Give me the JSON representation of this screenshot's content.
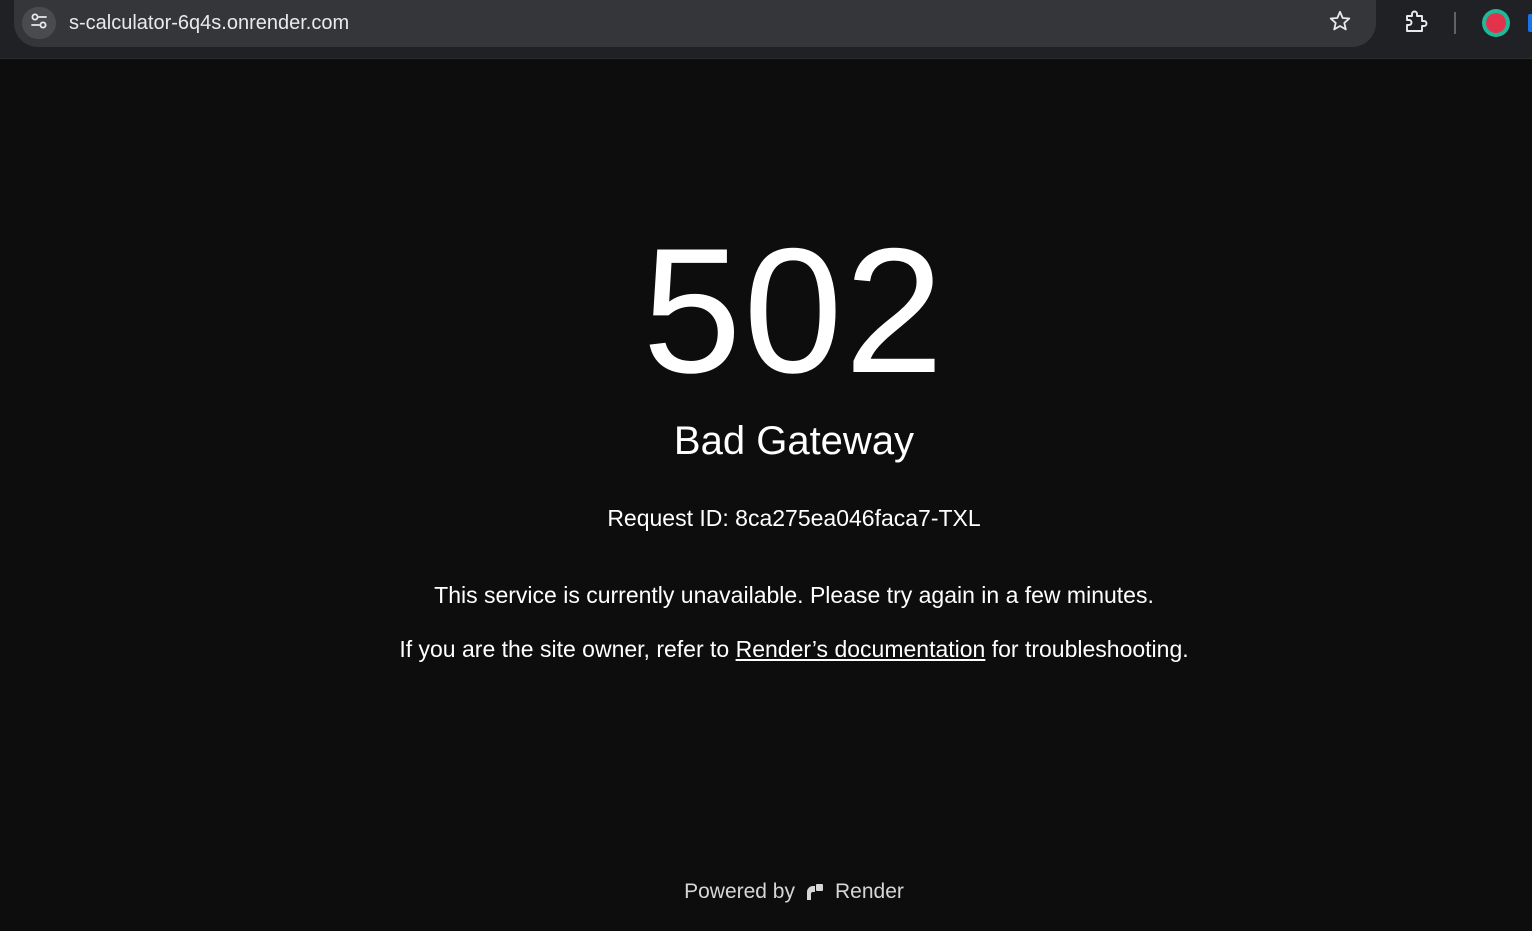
{
  "browser": {
    "url": "s-calculator-6q4s.onrender.com",
    "icons": {
      "site_info": "tune-icon",
      "bookmark": "star-icon",
      "extensions": "puzzle-icon",
      "profile": "avatar"
    }
  },
  "page": {
    "error_code": "502",
    "error_title": "Bad Gateway",
    "request_id": "Request ID: 8ca275ea046faca7-TXL",
    "message": "This service is currently unavailable. Please try again in a few minutes.",
    "owner_note_prefix": "If you are the site owner, refer to ",
    "docs_link": "Render’s documentation",
    "owner_note_suffix": " for troubleshooting.",
    "footer_prefix": "Powered by",
    "footer_brand": "Render"
  },
  "colors": {
    "background": "#0d0d0d",
    "text": "#ffffff",
    "chrome_bar": "#202124",
    "omnibox": "#35363a"
  }
}
